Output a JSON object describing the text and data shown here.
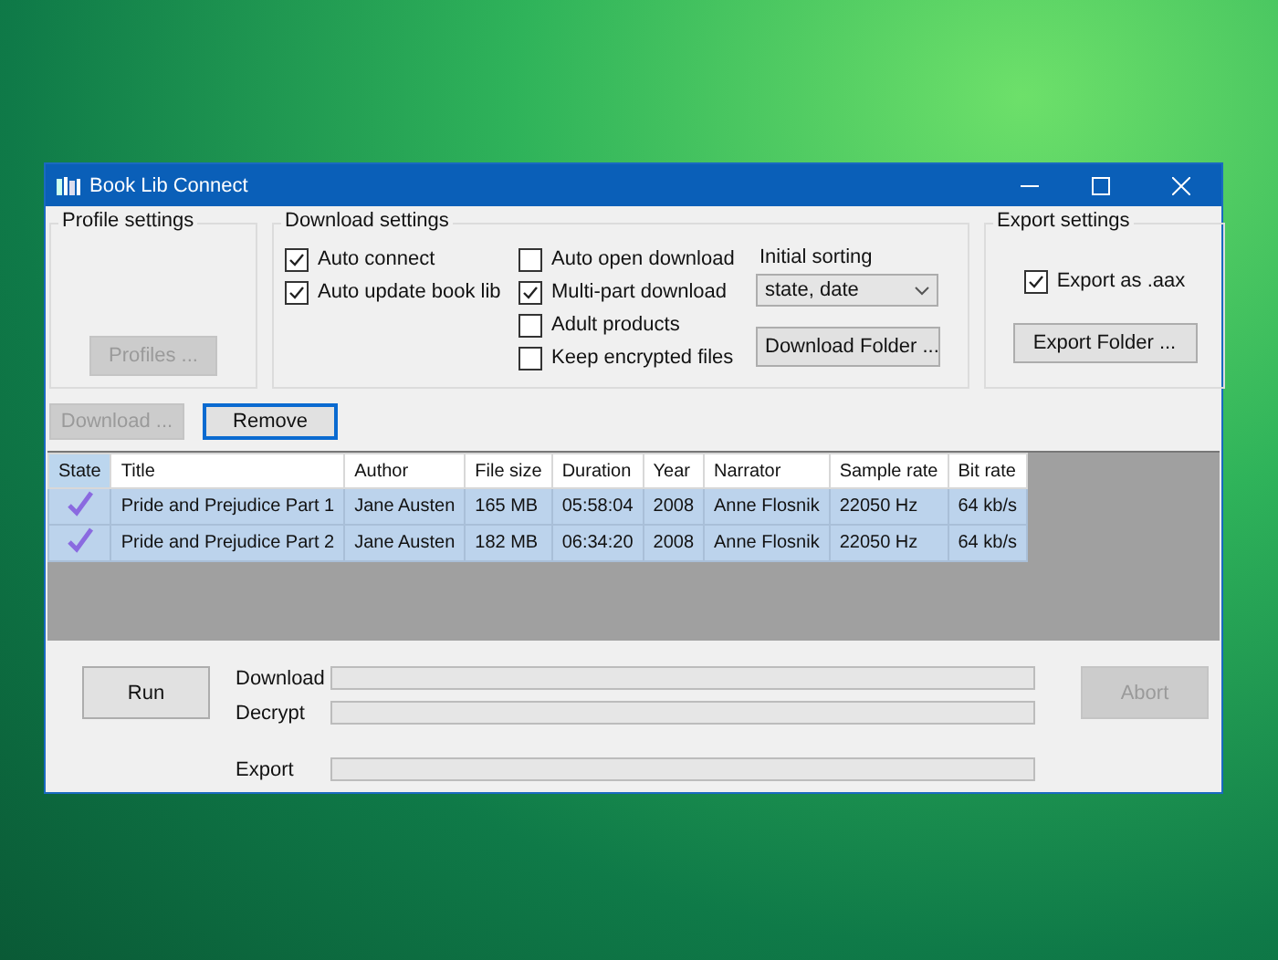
{
  "window": {
    "title": "Book Lib Connect"
  },
  "profile_settings": {
    "title": "Profile settings",
    "button": {
      "label": "Profiles ...",
      "disabled": true
    }
  },
  "download_settings": {
    "title": "Download settings",
    "options_left": [
      {
        "label": "Auto connect",
        "checked": true
      },
      {
        "label": "Auto update book lib",
        "checked": true
      }
    ],
    "options_right": [
      {
        "label": "Auto open download",
        "checked": false
      },
      {
        "label": "Multi-part download",
        "checked": true
      },
      {
        "label": "Adult products",
        "checked": false
      },
      {
        "label": "Keep encrypted files",
        "checked": false
      }
    ],
    "sorting_label": "Initial sorting",
    "sorting_value": "state, date",
    "folder_button": {
      "label": "Download Folder ...",
      "disabled": false
    }
  },
  "export_settings": {
    "title": "Export settings",
    "option": {
      "label": "Export as .aax",
      "checked": true
    },
    "folder_button": {
      "label": "Export Folder ...",
      "disabled": false
    }
  },
  "action_buttons": [
    {
      "label": "Download ...",
      "disabled": true,
      "focused": false
    },
    {
      "label": "Remove",
      "disabled": false,
      "focused": true
    }
  ],
  "table": {
    "columns": [
      "State",
      "Title",
      "Author",
      "File size",
      "Duration",
      "Year",
      "Narrator",
      "Sample rate",
      "Bit rate"
    ],
    "rows": [
      {
        "checked": true,
        "selected": true,
        "cells": [
          "",
          "Pride and Prejudice Part 1",
          "Jane Austen",
          "165 MB",
          "05:58:04",
          "2008",
          "Anne Flosnik",
          "22050 Hz",
          "64 kb/s"
        ]
      },
      {
        "checked": true,
        "selected": true,
        "cells": [
          "",
          "Pride and Prejudice Part 2",
          "Jane Austen",
          "182 MB",
          "06:34:20",
          "2008",
          "Anne Flosnik",
          "22050 Hz",
          "64 kb/s"
        ]
      }
    ]
  },
  "run_button": {
    "label": "Run",
    "disabled": false
  },
  "progress": [
    {
      "label": "Download",
      "level": 0
    },
    {
      "label": "Decrypt",
      "level": 0
    },
    {
      "label": "Export",
      "level": 0
    }
  ],
  "abort_button": {
    "label": "Abort",
    "disabled": true
  }
}
